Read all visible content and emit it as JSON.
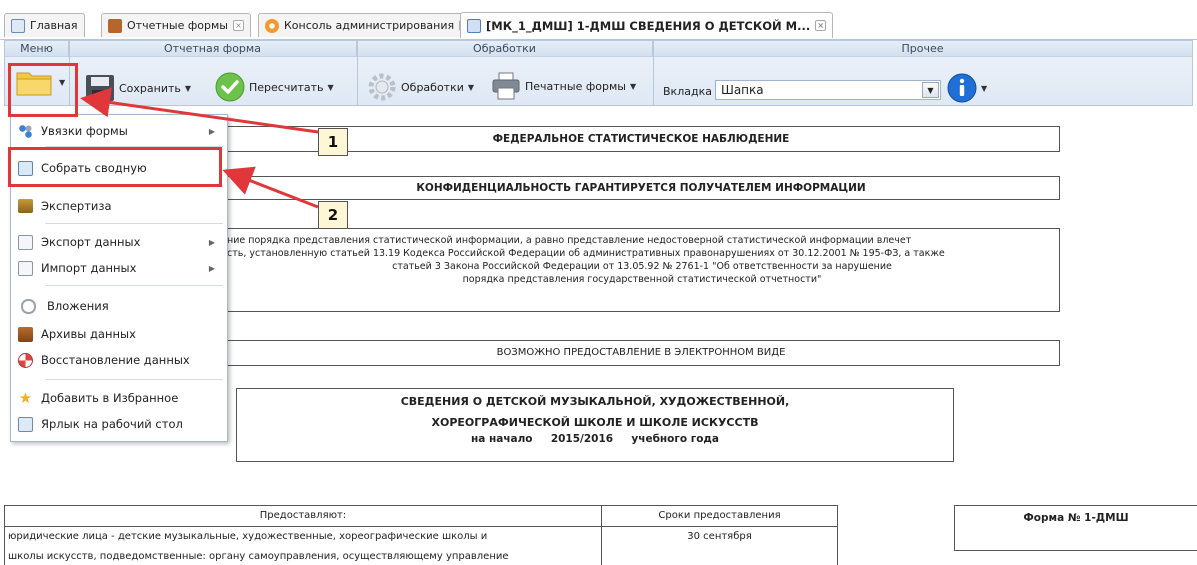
{
  "tabs": [
    {
      "label": "Главная",
      "closable": false,
      "icon": "home-icon"
    },
    {
      "label": "Отчетные формы",
      "closable": true,
      "icon": "book-icon"
    },
    {
      "label": "Консоль администрирования",
      "closable": true,
      "icon": "gear-orange-icon"
    },
    {
      "label": "[МК_1_ДМШ] 1-ДМШ СВЕДЕНИЯ О ДЕТСКОЙ М...",
      "closable": true,
      "icon": "form-icon",
      "active": true
    }
  ],
  "ribbon": {
    "groups": {
      "menu": "Меню",
      "report_form": "Отчетная форма",
      "processing": "Обработки",
      "other": "Прочее"
    },
    "save_label": "Сохранить",
    "recalc_label": "Пересчитать",
    "processing_label": "Обработки",
    "print_label": "Печатные формы",
    "tab_label": "Вкладка",
    "tab_value": "Шапка"
  },
  "menu": {
    "items": [
      {
        "label": "Увязки формы",
        "icon": "links-icon",
        "submenu": true
      },
      {
        "label": "Собрать сводную",
        "icon": "collect-icon",
        "submenu": false
      },
      {
        "label": "Экспертиза",
        "icon": "scales-icon",
        "submenu": false
      },
      {
        "label": "Экспорт данных",
        "icon": "export-icon",
        "submenu": true
      },
      {
        "label": "Импорт данных",
        "icon": "import-icon",
        "submenu": true
      },
      {
        "label": "Вложения",
        "icon": "paperclip-icon",
        "submenu": false
      },
      {
        "label": "Архивы данных",
        "icon": "archive-icon",
        "submenu": false
      },
      {
        "label": "Восстановление данных",
        "icon": "lifebuoy-icon",
        "submenu": false
      },
      {
        "label": "Добавить в Избранное",
        "icon": "star-icon",
        "submenu": false
      },
      {
        "label": "Ярлык на рабочий стол",
        "icon": "shortcut-icon",
        "submenu": false
      }
    ]
  },
  "callouts": [
    "1",
    "2"
  ],
  "document": {
    "federal": "ФЕДЕРАЛЬНОЕ СТАТИСТИЧЕСКОЕ НАБЛЮДЕНИЕ",
    "confidential": "КОНФИДЕНЦИАЛЬНОСТЬ ГАРАНТИРУЕТСЯ ПОЛУЧАТЕЛЕМ ИНФОРМАЦИИ",
    "legal_line1": "ние порядка представления статистической информации, а равно представление недостоверной статистической информации влечет",
    "legal_line2": "сть, установленную статьей 13.19 Кодекса Российской Федерации об административных правонарушениях от 30.12.2001 № 195-ФЗ, а также",
    "legal_line3": "статьей 3 Закона Российской Федерации от 13.05.92 № 2761-1 \"Об ответственности за нарушение",
    "legal_line4": "порядка представления государственной статистической отчетности\"",
    "electronic": "ВОЗМОЖНО ПРЕДОСТАВЛЕНИЕ В ЭЛЕКТРОННОМ ВИДЕ",
    "title_line1": "СВЕДЕНИЯ О ДЕТСКОЙ МУЗЫКАЛЬНОЙ, ХУДОЖЕСТВЕННОЙ,",
    "title_line2": "ХОРЕОГРАФИЧЕСКОЙ ШКОЛЕ И ШКОЛЕ ИСКУССТВ",
    "title_start": "на начало",
    "title_year": "2015/2016",
    "title_suffix": "учебного года",
    "col_provide": "Предоставляют:",
    "col_deadline": "Сроки предоставления",
    "provide_line1": "юридические лица - детские музыкальные, художественные, хореографические школы и",
    "provide_line2": "школы искусств, подведомственные: органу самоуправления, осуществляющему управление",
    "deadline": "30 сентября",
    "form_no": "Форма № 1-ДМШ"
  }
}
